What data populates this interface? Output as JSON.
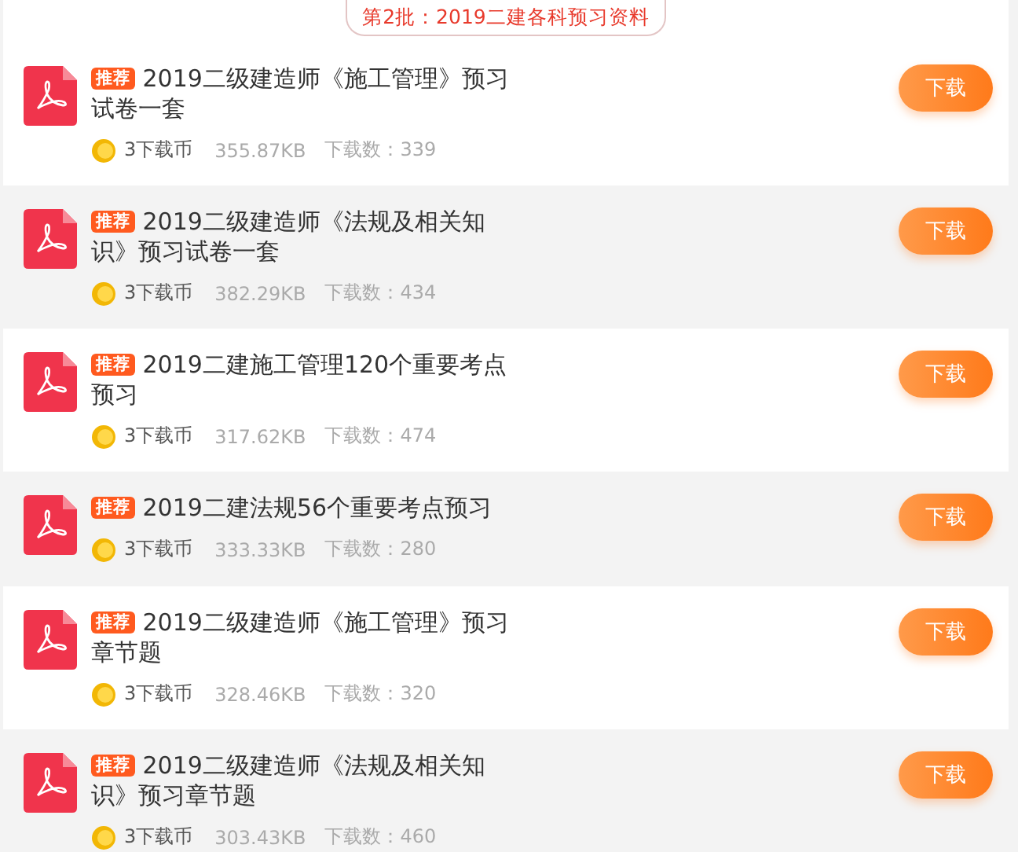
{
  "header": {
    "title": "第2批：2019二建各科预习资料"
  },
  "items": [
    {
      "badge": "推荐",
      "title": "2019二级建造师《施工管理》预习试卷一套",
      "cost": "3下载币",
      "size": "355.87KB",
      "downloads": "下载数：339",
      "button": "下载"
    },
    {
      "badge": "推荐",
      "title": "2019二级建造师《法规及相关知识》预习试卷一套",
      "cost": "3下载币",
      "size": "382.29KB",
      "downloads": "下载数：434",
      "button": "下载"
    },
    {
      "badge": "推荐",
      "title": "2019二建施工管理120个重要考点预习",
      "cost": "3下载币",
      "size": "317.62KB",
      "downloads": "下载数：474",
      "button": "下载"
    },
    {
      "badge": "推荐",
      "title": "2019二建法规56个重要考点预习",
      "cost": "3下载币",
      "size": "333.33KB",
      "downloads": "下载数：280",
      "button": "下载"
    },
    {
      "badge": "推荐",
      "title": "2019二级建造师《施工管理》预习章节题",
      "cost": "3下载币",
      "size": "328.46KB",
      "downloads": "下载数：320",
      "button": "下载"
    },
    {
      "badge": "推荐",
      "title": "2019二级建造师《法规及相关知识》预习章节题",
      "cost": "3下载币",
      "size": "303.43KB",
      "downloads": "下载数：460",
      "button": "下载"
    }
  ]
}
